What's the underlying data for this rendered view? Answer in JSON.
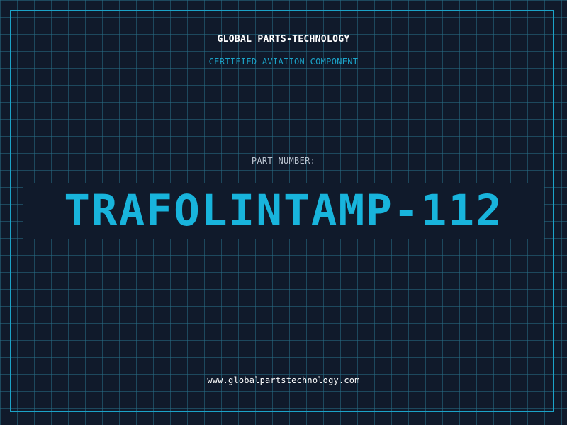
{
  "header": {
    "company": "GLOBAL PARTS-TECHNOLOGY",
    "subtitle": "CERTIFIED AVIATION COMPONENT"
  },
  "part": {
    "label": "PART NUMBER:",
    "number": "TRAFOLINTAMP-112"
  },
  "footer": {
    "website": "www.globalpartstechnology.com"
  },
  "colors": {
    "background": "#101a2b",
    "grid": "#286e87",
    "accent": "#1ba3c8",
    "text": "#ffffff",
    "muted": "#b9c3cf"
  }
}
